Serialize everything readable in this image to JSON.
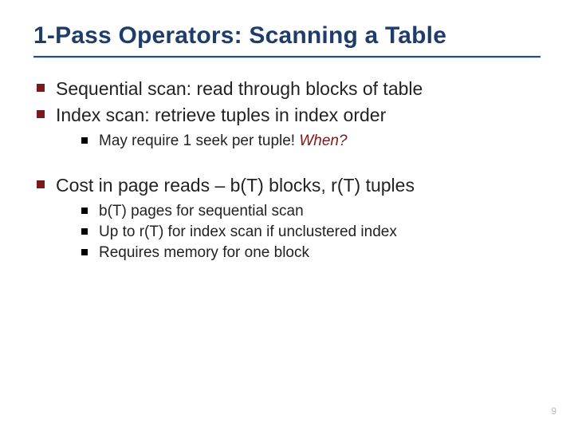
{
  "title": "1-Pass Operators: Scanning a Table",
  "bullets": {
    "seq_scan": "Sequential scan:  read through blocks of table",
    "idx_scan": "Index scan:  retrieve tuples in index order",
    "seek_prefix": "May require 1 seek per tuple!  ",
    "seek_when": "When?",
    "cost": "Cost in page reads – b(T) blocks, r(T) tuples",
    "cost_sub1": "b(T) pages for sequential scan",
    "cost_sub2": "Up to r(T) for index scan if unclustered index",
    "cost_sub3": "Requires memory for one block"
  },
  "page_number": "9"
}
